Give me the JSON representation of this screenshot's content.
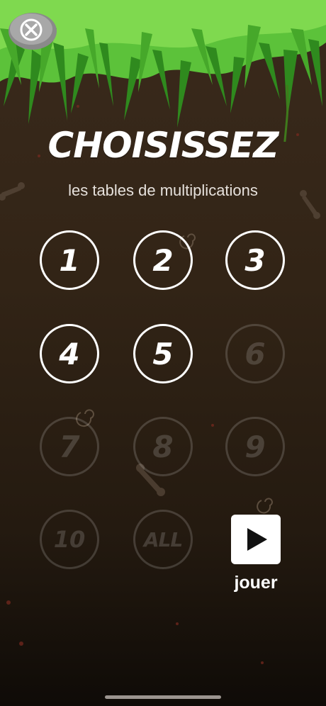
{
  "header": {
    "title": "CHOISISSEZ",
    "subtitle": "les tables de multiplications"
  },
  "tables": [
    {
      "label": "1",
      "selected": true
    },
    {
      "label": "2",
      "selected": true
    },
    {
      "label": "3",
      "selected": true
    },
    {
      "label": "4",
      "selected": true
    },
    {
      "label": "5",
      "selected": true
    },
    {
      "label": "6",
      "selected": false
    },
    {
      "label": "7",
      "selected": false
    },
    {
      "label": "8",
      "selected": false
    },
    {
      "label": "9",
      "selected": false
    },
    {
      "label": "10",
      "selected": false
    },
    {
      "label": "ALL",
      "selected": false
    }
  ],
  "play": {
    "label": "jouer",
    "icon": "play-icon"
  },
  "close": {
    "icon": "close-icon"
  },
  "colors": {
    "soil_top": "#3a2a1c",
    "soil_bottom": "#0f0b07",
    "leaf": "#4caf2a",
    "leaf_dark": "#2e7d1a",
    "button_active": "#ffffff",
    "button_inactive": "#5a4f45"
  }
}
